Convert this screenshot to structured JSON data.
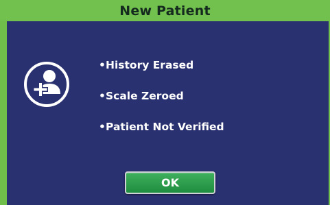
{
  "dialog": {
    "title": "New Patient",
    "icon": "patient-add-icon",
    "items": [
      {
        "bullet": "•",
        "text": "History Erased"
      },
      {
        "bullet": "•",
        "text": "Scale Zeroed"
      },
      {
        "bullet": "•",
        "text": "Patient Not Verified"
      }
    ],
    "ok_label": "OK"
  },
  "colors": {
    "frame": "#6fbf4a",
    "title_bar": "#72c04d",
    "panel": "#2a3170",
    "button": "#2aa04b"
  }
}
